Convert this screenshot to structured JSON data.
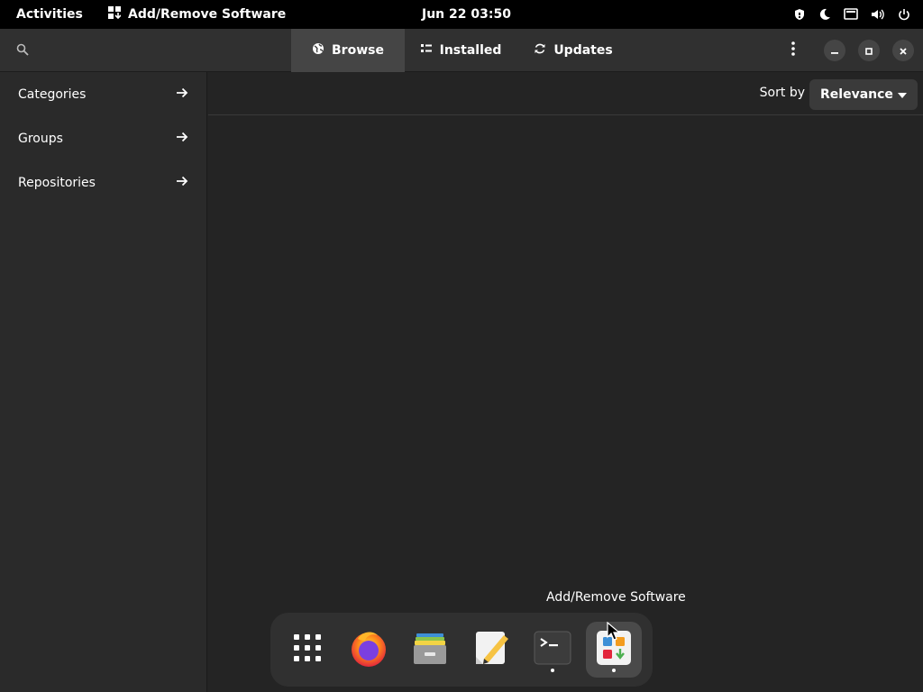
{
  "topbar": {
    "activities": "Activities",
    "app_name": "Add/Remove Software",
    "clock": "Jun 22  03:50"
  },
  "header": {
    "tabs": [
      {
        "label": "Browse",
        "active": true,
        "icon": "globe-icon"
      },
      {
        "label": "Installed",
        "active": false,
        "icon": "list-icon"
      },
      {
        "label": "Updates",
        "active": false,
        "icon": "refresh-icon"
      }
    ]
  },
  "sidebar": {
    "items": [
      {
        "label": "Categories"
      },
      {
        "label": "Groups"
      },
      {
        "label": "Repositories"
      }
    ]
  },
  "main": {
    "sort_label": "Sort by",
    "sort_value": "Relevance"
  },
  "dock": {
    "tooltip": "Add/Remove Software",
    "items": [
      {
        "name": "show-apps",
        "running": false
      },
      {
        "name": "firefox",
        "running": false
      },
      {
        "name": "file-roller",
        "running": false
      },
      {
        "name": "text-editor",
        "running": false
      },
      {
        "name": "terminal",
        "running": true
      },
      {
        "name": "add-remove-software",
        "running": true,
        "active": true
      }
    ]
  },
  "colors": {
    "topbar_bg": "#000000",
    "headerbar_bg": "#303030",
    "sidebar_bg": "#2a2a2a",
    "main_bg": "#242424",
    "active_tab_bg": "#454545"
  }
}
